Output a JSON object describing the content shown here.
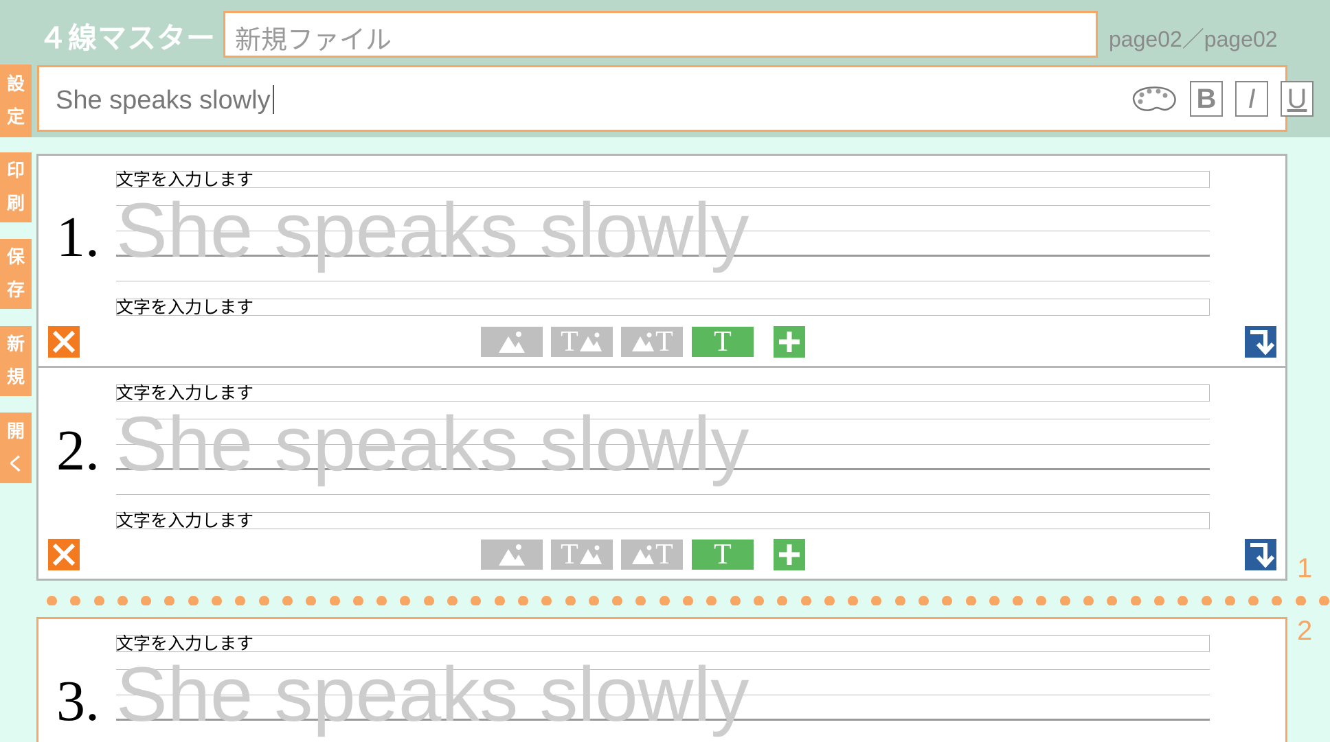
{
  "app": {
    "title": "４線マスター",
    "filename": "新規ファイル",
    "page_counter": "page02／page02"
  },
  "editor": {
    "sentence": "She speaks slowly",
    "palette_icon": "palette-icon",
    "bold_label": "B",
    "italic_label": "I",
    "underline_label": "U"
  },
  "sidebar": [
    {
      "chars": [
        "設",
        "定"
      ],
      "action": "settings"
    },
    {
      "chars": [
        "印",
        "刷"
      ],
      "action": "print"
    },
    {
      "chars": [
        "保",
        "存"
      ],
      "action": "save"
    },
    {
      "chars": [
        "新",
        "規"
      ],
      "action": "new"
    },
    {
      "chars": [
        "開",
        "く"
      ],
      "action": "open"
    }
  ],
  "worksheet": {
    "rows": [
      {
        "number": "1.",
        "top_label": "文字を入力します",
        "trace_text": "She speaks slowly",
        "bottom_label": "文字を入力します"
      },
      {
        "number": "2.",
        "top_label": "文字を入力します",
        "trace_text": "She speaks slowly",
        "bottom_label": "文字を入力します"
      },
      {
        "number": "3.",
        "top_label": "文字を入力します",
        "trace_text": "She speaks slowly",
        "bottom_label": ""
      }
    ],
    "tools": {
      "text_only_label": "T",
      "text_image_label": "T",
      "image_text_label": "T"
    }
  },
  "pagination": {
    "marker_1": "1",
    "marker_2": "2"
  },
  "colors": {
    "accent": "#f7a664",
    "header": "#bad8ca",
    "background": "#e0fbf1",
    "delete": "#f47a1f",
    "add": "#5cb85c",
    "move_down": "#2a5e9d"
  }
}
